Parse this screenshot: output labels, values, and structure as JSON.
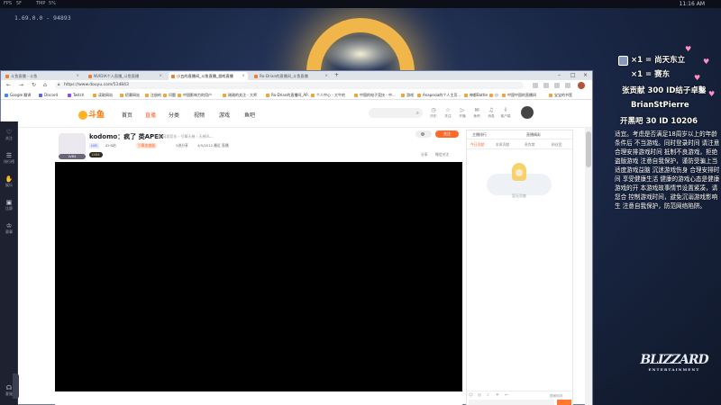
{
  "desktop": {
    "topbar_stats": [
      "FPS",
      "5F",
      "TMP",
      "5%"
    ],
    "clock": "11:16 AM",
    "version": "1.69.0.0 - 94893"
  },
  "game_sidebar": {
    "items": [
      {
        "icon": "heart-icon",
        "label": "关注"
      },
      {
        "icon": "list-icon",
        "label": "排行榜"
      },
      {
        "icon": "hand-icon",
        "label": "娱乐"
      },
      {
        "icon": "gamepad-icon",
        "label": "比赛"
      },
      {
        "icon": "trophy-icon",
        "label": "赛事"
      },
      {
        "icon": "gift-icon",
        "label": "直播"
      }
    ],
    "bottom_label": "客服"
  },
  "browser": {
    "tabs": [
      {
        "label": "斗鱼直播 - 斗鱼"
      },
      {
        "label": "NVIDIA个人直播_斗鱼直播"
      },
      {
        "label": "小五的直播间_斗鱼直播_游戏直播"
      },
      {
        "label": "Ro-Drian的直播间_斗鱼直播"
      }
    ],
    "url": "https://www.douyu.com/514843",
    "bookmarks": [
      "Google 翻译",
      "Discord",
      "Twitch",
      "读取网站",
      "招募网站",
      "注册的",
      "问题",
      "中国影响力的用户",
      "刚刚的关注 - 大师",
      "Ro-Drian的直播间_AP...",
      "个人中心 - 大牛的",
      "中国的电子竞技 - 中...",
      "游戏",
      "Anapesia的个人主页...",
      "神都Battle",
      "小",
      "中国中国的直播间",
      "宝宝的书签"
    ]
  },
  "site": {
    "logo": "斗鱼",
    "nav": [
      "首页",
      "直播",
      "分类",
      "视频",
      "游戏",
      "鱼吧"
    ],
    "nav_active_index": 1,
    "header_icons": [
      {
        "icon": "clock-icon",
        "label": "历史"
      },
      {
        "icon": "star-icon",
        "label": "关注"
      },
      {
        "icon": "play-icon",
        "label": "开播"
      },
      {
        "icon": "chat-icon",
        "label": "鱼吧"
      },
      {
        "icon": "bell-icon",
        "label": "消息"
      },
      {
        "icon": "download-icon",
        "label": "客户端"
      }
    ],
    "sidebar": [
      {
        "icon": "heart-icon",
        "label": "关注"
      },
      {
        "icon": "list-icon",
        "label": "排行"
      },
      {
        "icon": "hand-icon",
        "label": "娱乐"
      },
      {
        "icon": "gamepad-icon",
        "label": "比赛"
      },
      {
        "icon": "trophy-icon",
        "label": "赛事"
      }
    ],
    "sidebar_bottom": "客服"
  },
  "room": {
    "title": "kodomo：疯了 类APEX",
    "meta": "举报  网游竞技 › 引擎天梯 › 天梯VL...",
    "tags": [
      "LV8",
      "ID:B站",
      "引擎加速器",
      "3进分享",
      "4/5/2012 最近 直播"
    ],
    "badge": "LV84",
    "follow_label": "关注",
    "tools": [
      "分享",
      "微信关注"
    ]
  },
  "chat": {
    "top_tabs": [
      "主播排行",
      "直播精彩"
    ],
    "tabs": [
      "今日贡献",
      "本周贡献",
      "贵宾席",
      "粉丝团"
    ],
    "empty_text": "暂无贡献",
    "bottom_check": "屏蔽特效"
  },
  "overlay": {
    "health_text": "适宜。考虑是否满足18周岁以上的年龄条件后 不当游戏。同时登录时间 请注意合理安排游戏时间 抵制不良游戏，拒绝盗版游戏 注意自我保护，谨防受骗上当 适度游戏益脑 沉迷游戏伤身 合理安排时间 享受健康生活 健康的游戏心态是健康游戏的开 本游戏故事情节设置紧凑，请您合 控制游戏时间，避免沉溺游戏影响生 注意自我保护，防范网络陷阱。",
    "danmaku": [
      {
        "text": "×1 = 尚天东立"
      },
      {
        "text": "×1 = 赛东"
      },
      {
        "text": "张贡献 300 ID结子卓鑿"
      },
      {
        "text": "BrianStPierre"
      },
      {
        "text": "开黑吧 30 ID 10206"
      }
    ],
    "brand": "BLIZZARD",
    "brand_sub": "ENTERTAINMENT"
  }
}
